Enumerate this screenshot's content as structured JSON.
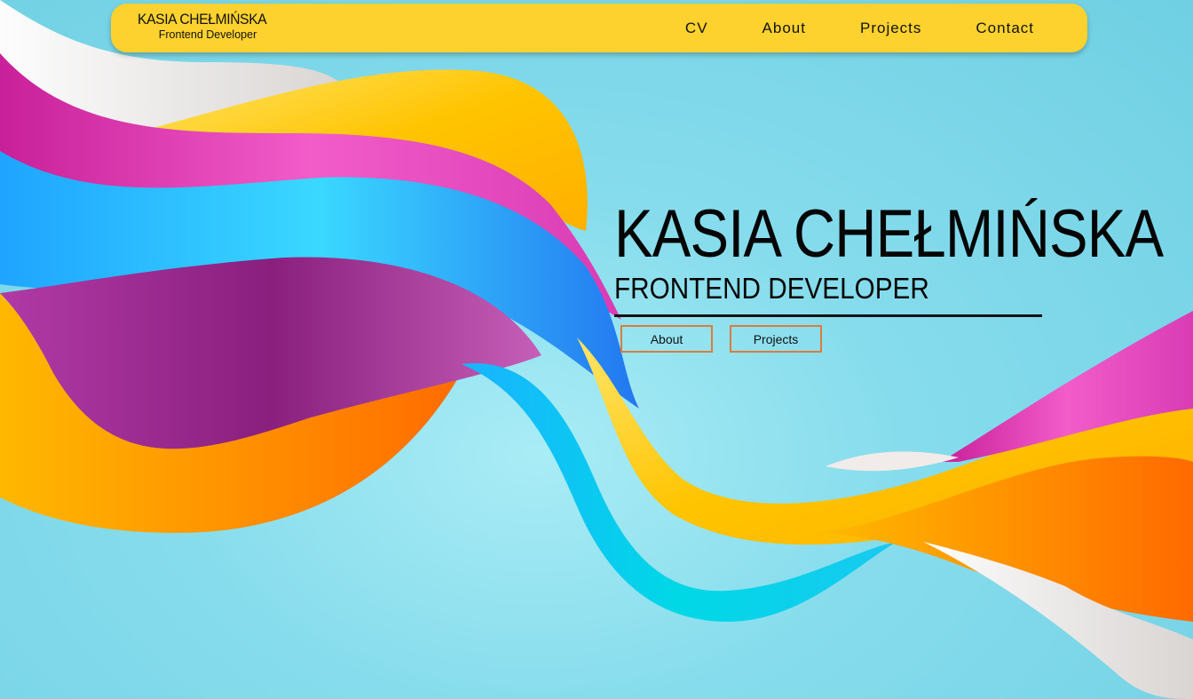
{
  "nav": {
    "brand_name": "KASIA CHEŁMIŃSKA",
    "brand_subtitle": "Frontend Developer",
    "links": [
      "CV",
      "About",
      "Projects",
      "Contact"
    ]
  },
  "hero": {
    "title": "KASIA CHEŁMIŃSKA",
    "subtitle": "FRONTEND DEVELOPER",
    "buttons": [
      "About",
      "Projects"
    ]
  },
  "colors": {
    "navbar_bg": "#fdd22f",
    "background": "#86dcec",
    "button_border": "#d97d3c",
    "text": "#111111"
  }
}
